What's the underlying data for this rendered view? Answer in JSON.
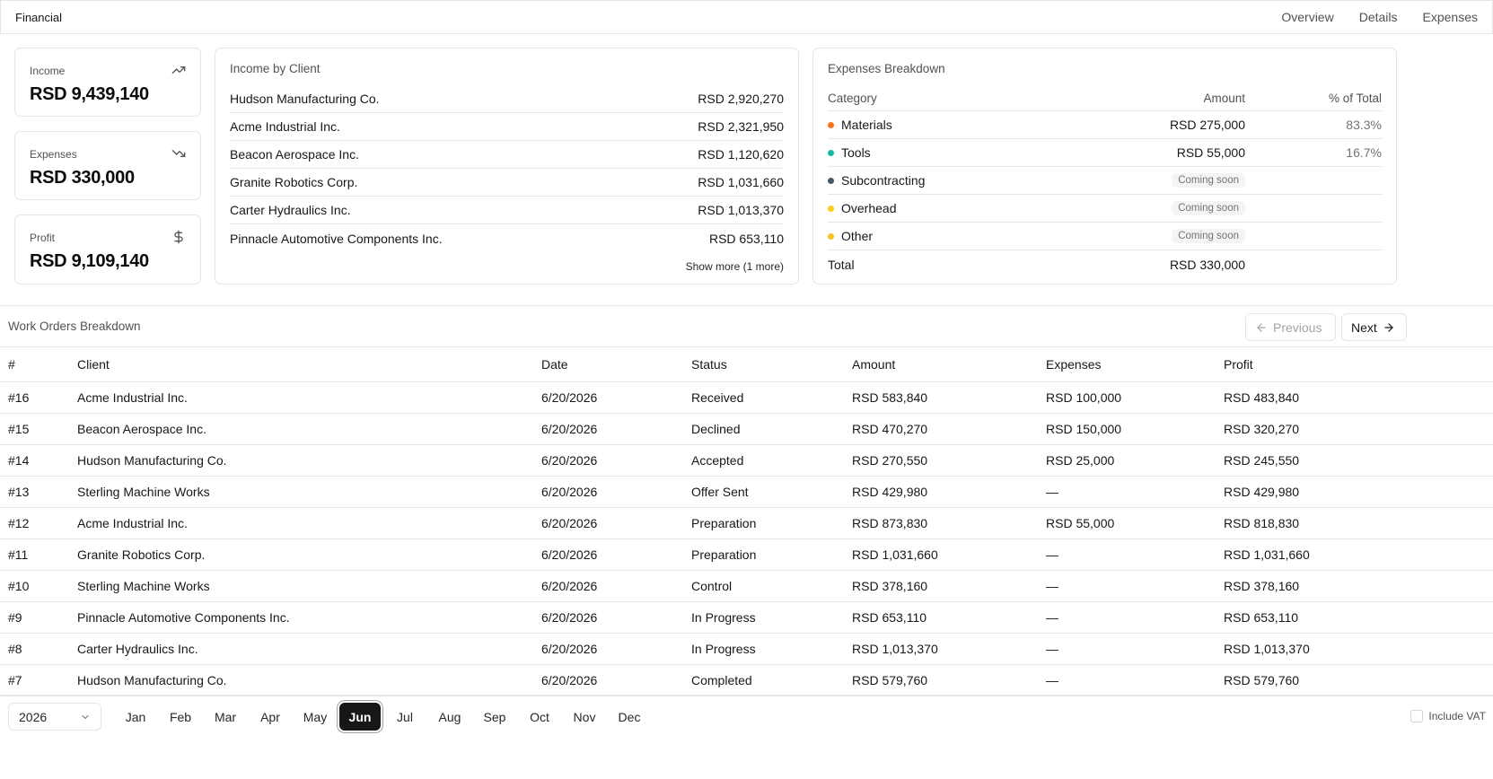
{
  "header": {
    "title": "Financial",
    "nav": [
      "Overview",
      "Details",
      "Expenses"
    ]
  },
  "stats": [
    {
      "label": "Income",
      "value": "RSD 9,439,140",
      "icon": "trending-up-icon"
    },
    {
      "label": "Expenses",
      "value": "RSD 330,000",
      "icon": "trending-down-icon"
    },
    {
      "label": "Profit",
      "value": "RSD 9,109,140",
      "icon": "dollar-icon"
    }
  ],
  "income_by_client": {
    "title": "Income by Client",
    "rows": [
      {
        "client": "Hudson Manufacturing Co.",
        "amount": "RSD 2,920,270"
      },
      {
        "client": "Acme Industrial Inc.",
        "amount": "RSD 2,321,950"
      },
      {
        "client": "Beacon Aerospace Inc.",
        "amount": "RSD 1,120,620"
      },
      {
        "client": "Granite Robotics Corp.",
        "amount": "RSD 1,031,660"
      },
      {
        "client": "Carter Hydraulics Inc.",
        "amount": "RSD 1,013,370"
      },
      {
        "client": "Pinnacle Automotive Components Inc.",
        "amount": "RSD 653,110"
      }
    ],
    "show_more": "Show more (1 more)"
  },
  "expenses_breakdown": {
    "title": "Expenses Breakdown",
    "headers": {
      "category": "Category",
      "amount": "Amount",
      "pct": "% of Total"
    },
    "rows": [
      {
        "category": "Materials",
        "color": "#f97316",
        "amount": "RSD 275,000",
        "pct": "83.3%",
        "coming_soon": ""
      },
      {
        "category": "Tools",
        "color": "#14b8a6",
        "amount": "RSD 55,000",
        "pct": "16.7%",
        "coming_soon": ""
      },
      {
        "category": "Subcontracting",
        "color": "#475569",
        "amount": "",
        "pct": "",
        "coming_soon": "Coming soon"
      },
      {
        "category": "Overhead",
        "color": "#facc15",
        "amount": "",
        "pct": "",
        "coming_soon": "Coming soon"
      },
      {
        "category": "Other",
        "color": "#fbbf24",
        "amount": "",
        "pct": "",
        "coming_soon": "Coming soon"
      }
    ],
    "total_label": "Total",
    "total_amount": "RSD 330,000"
  },
  "work_orders": {
    "title": "Work Orders Breakdown",
    "prev_label": "Previous",
    "next_label": "Next",
    "columns": [
      "#",
      "Client",
      "Date",
      "Status",
      "Amount",
      "Expenses",
      "Profit"
    ],
    "rows": [
      {
        "id": "#16",
        "client": "Acme Industrial Inc.",
        "date": "6/20/2026",
        "status": "Received",
        "amount": "RSD 583,840",
        "expenses": "RSD 100,000",
        "profit": "RSD 483,840"
      },
      {
        "id": "#15",
        "client": "Beacon Aerospace Inc.",
        "date": "6/20/2026",
        "status": "Declined",
        "amount": "RSD 470,270",
        "expenses": "RSD 150,000",
        "profit": "RSD 320,270"
      },
      {
        "id": "#14",
        "client": "Hudson Manufacturing Co.",
        "date": "6/20/2026",
        "status": "Accepted",
        "amount": "RSD 270,550",
        "expenses": "RSD 25,000",
        "profit": "RSD 245,550"
      },
      {
        "id": "#13",
        "client": "Sterling Machine Works",
        "date": "6/20/2026",
        "status": "Offer Sent",
        "amount": "RSD 429,980",
        "expenses": "—",
        "profit": "RSD 429,980"
      },
      {
        "id": "#12",
        "client": "Acme Industrial Inc.",
        "date": "6/20/2026",
        "status": "Preparation",
        "amount": "RSD 873,830",
        "expenses": "RSD 55,000",
        "profit": "RSD 818,830"
      },
      {
        "id": "#11",
        "client": "Granite Robotics Corp.",
        "date": "6/20/2026",
        "status": "Preparation",
        "amount": "RSD 1,031,660",
        "expenses": "—",
        "profit": "RSD 1,031,660"
      },
      {
        "id": "#10",
        "client": "Sterling Machine Works",
        "date": "6/20/2026",
        "status": "Control",
        "amount": "RSD 378,160",
        "expenses": "—",
        "profit": "RSD 378,160"
      },
      {
        "id": "#9",
        "client": "Pinnacle Automotive Components Inc.",
        "date": "6/20/2026",
        "status": "In Progress",
        "amount": "RSD 653,110",
        "expenses": "—",
        "profit": "RSD 653,110"
      },
      {
        "id": "#8",
        "client": "Carter Hydraulics Inc.",
        "date": "6/20/2026",
        "status": "In Progress",
        "amount": "RSD 1,013,370",
        "expenses": "—",
        "profit": "RSD 1,013,370"
      },
      {
        "id": "#7",
        "client": "Hudson Manufacturing Co.",
        "date": "6/20/2026",
        "status": "Completed",
        "amount": "RSD 579,760",
        "expenses": "—",
        "profit": "RSD 579,760"
      }
    ]
  },
  "footer": {
    "year": "2026",
    "months": [
      "Jan",
      "Feb",
      "Mar",
      "Apr",
      "May",
      "Jun",
      "Jul",
      "Aug",
      "Sep",
      "Oct",
      "Nov",
      "Dec"
    ],
    "active_month": "Jun",
    "vat_label": "Include VAT",
    "vat_checked": false
  },
  "colors": {
    "profit": "#16a34a",
    "active_month_bg": "#171717"
  }
}
